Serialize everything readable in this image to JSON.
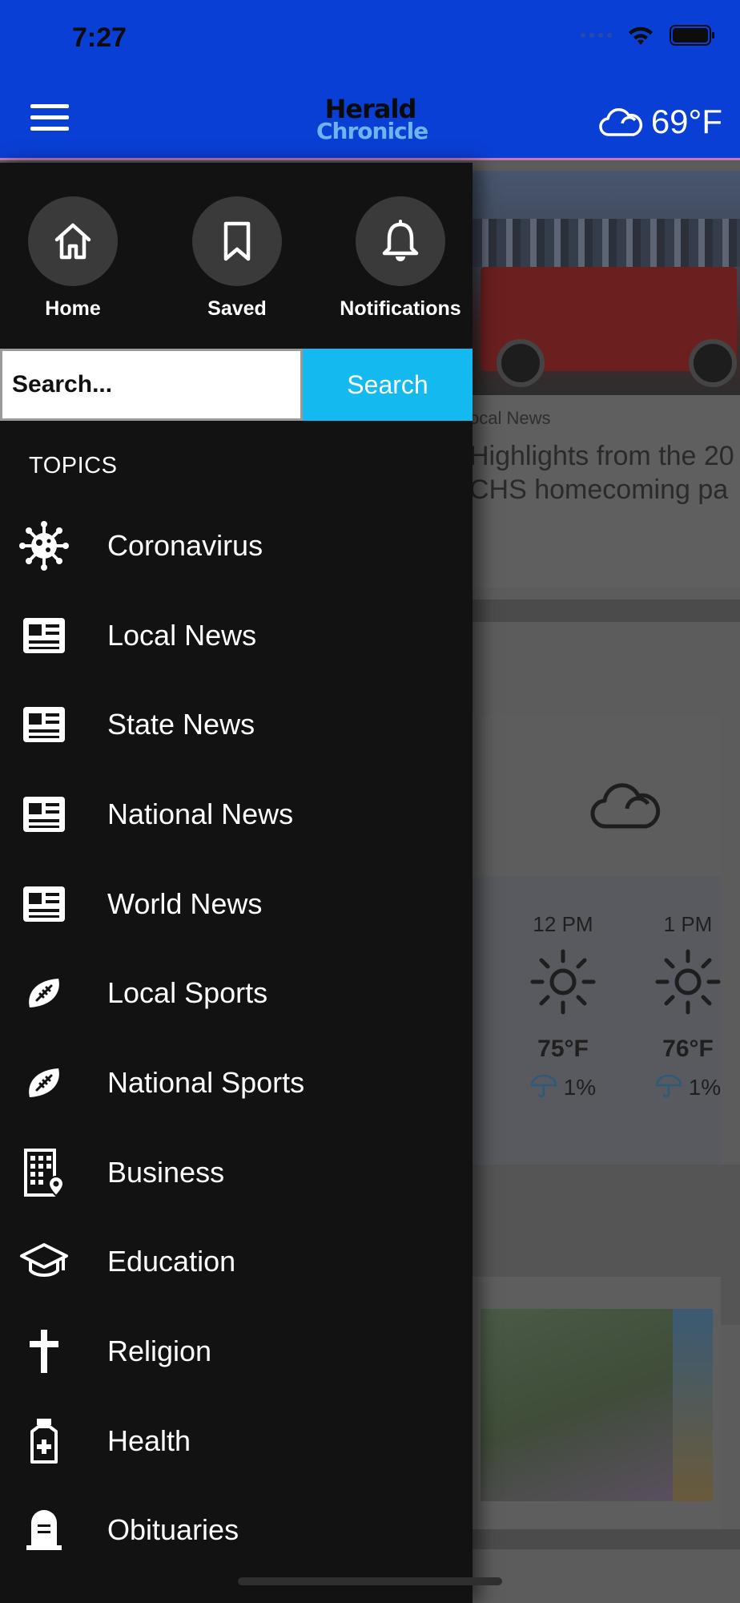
{
  "status_bar": {
    "time": "7:27"
  },
  "header": {
    "logo_line1": "Herald",
    "logo_line2": "Chronicle",
    "weather_temp": "69°F",
    "weather_icon": "cloud-icon"
  },
  "drawer": {
    "quick_links": [
      {
        "label": "Home",
        "icon": "home-icon"
      },
      {
        "label": "Saved",
        "icon": "bookmark-icon"
      },
      {
        "label": "Notifications",
        "icon": "bell-icon"
      }
    ],
    "search": {
      "placeholder": "Search...",
      "button_label": "Search"
    },
    "topics_header": "TOPICS",
    "topics": [
      {
        "label": "Coronavirus",
        "icon": "virus-icon"
      },
      {
        "label": "Local News",
        "icon": "newspaper-icon"
      },
      {
        "label": "State News",
        "icon": "newspaper-icon"
      },
      {
        "label": "National News",
        "icon": "newspaper-icon"
      },
      {
        "label": "World News",
        "icon": "newspaper-icon"
      },
      {
        "label": "Local Sports",
        "icon": "football-icon"
      },
      {
        "label": "National Sports",
        "icon": "football-icon"
      },
      {
        "label": "Business",
        "icon": "building-icon"
      },
      {
        "label": "Education",
        "icon": "graduation-cap-icon"
      },
      {
        "label": "Religion",
        "icon": "cross-icon"
      },
      {
        "label": "Health",
        "icon": "medicine-bottle-icon"
      },
      {
        "label": "Obituaries",
        "icon": "headstone-icon"
      }
    ]
  },
  "background": {
    "article_category": "ocal News",
    "article_title_line1": "Highlights from the 20",
    "article_title_line2": "CHS homecoming pa",
    "forecast": [
      {
        "time": "12 PM",
        "temp": "75°F",
        "rain": "1%"
      },
      {
        "time": "1 PM",
        "temp": "76°F",
        "rain": "1%"
      }
    ]
  },
  "colors": {
    "header_blue": "#0a3fd6",
    "search_button": "#14b9f0",
    "drawer_bg": "#121212"
  }
}
